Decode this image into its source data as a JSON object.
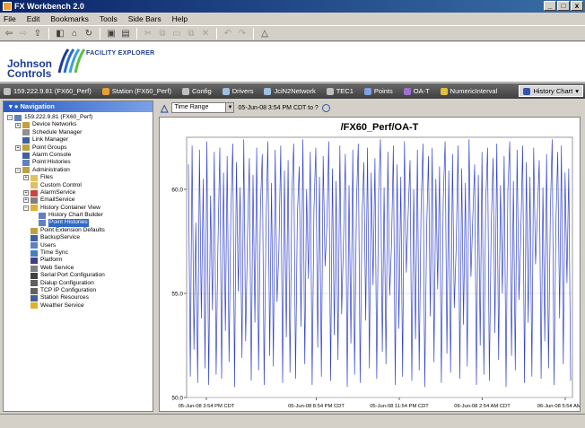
{
  "window": {
    "title": "FX Workbench 2.0",
    "minimize": "_",
    "maximize": "□",
    "close": "x"
  },
  "menu": [
    "File",
    "Edit",
    "Bookmarks",
    "Tools",
    "Side Bars",
    "Help"
  ],
  "banner": {
    "brand_line1": "Johnson",
    "brand_line2": "Controls",
    "product": "FACILITY EXPLORER"
  },
  "path": [
    {
      "label": "159.222.9.81 (FX60_Perf)",
      "color": "#c0c0c0"
    },
    {
      "label": "Station (FX60_Perf)",
      "color": "#e8a030"
    },
    {
      "label": "Config",
      "color": "#c0c0c0"
    },
    {
      "label": "Drivers",
      "color": "#a0c0e0"
    },
    {
      "label": "JciN2Network",
      "color": "#a0c0e0"
    },
    {
      "label": "TEC1",
      "color": "#c0c0c0"
    },
    {
      "label": "Points",
      "color": "#80a0e0"
    },
    {
      "label": "OA-T",
      "color": "#a070d0"
    },
    {
      "label": "NumericInterval",
      "color": "#e0c040"
    }
  ],
  "path_current": "History Chart",
  "nav": {
    "title": "Navigation",
    "items": [
      {
        "label": "159.222.9.81 (FX60_Perf)",
        "level": 0,
        "exp": "−",
        "color": "#6080c0"
      },
      {
        "label": "Device Networks",
        "level": 1,
        "exp": "+",
        "color": "#c0a040"
      },
      {
        "label": "Schedule Manager",
        "level": 1,
        "exp": "",
        "color": "#909090"
      },
      {
        "label": "Link Manager",
        "level": 1,
        "exp": "",
        "color": "#4060a0"
      },
      {
        "label": "Point Groups",
        "level": 1,
        "exp": "+",
        "color": "#c0a040"
      },
      {
        "label": "Alarm Console",
        "level": 1,
        "exp": "",
        "color": "#4060a0"
      },
      {
        "label": "Point Histories",
        "level": 1,
        "exp": "",
        "color": "#6080c0"
      },
      {
        "label": "Administration",
        "level": 1,
        "exp": "−",
        "color": "#c0a040"
      },
      {
        "label": "Files",
        "level": 2,
        "exp": "+",
        "color": "#e0c060"
      },
      {
        "label": "Custom Control",
        "level": 2,
        "exp": "",
        "color": "#e0c060"
      },
      {
        "label": "AlarmService",
        "level": 2,
        "exp": "+",
        "color": "#d04040"
      },
      {
        "label": "EmailService",
        "level": 2,
        "exp": "+",
        "color": "#808080"
      },
      {
        "label": "History Container View",
        "level": 2,
        "exp": "−",
        "color": "#e0b030"
      },
      {
        "label": "History Chart Builder",
        "level": 3,
        "exp": "",
        "color": "#6080c0"
      },
      {
        "label": "Point Histories",
        "level": 3,
        "exp": "",
        "color": "#6080c0",
        "selected": true
      },
      {
        "label": "Point Extension Defaults",
        "level": 2,
        "exp": "",
        "color": "#c0a040"
      },
      {
        "label": "BackupService",
        "level": 2,
        "exp": "",
        "color": "#4060a0"
      },
      {
        "label": "Users",
        "level": 2,
        "exp": "",
        "color": "#6080c0"
      },
      {
        "label": "Time Sync",
        "level": 2,
        "exp": "",
        "color": "#4080c0"
      },
      {
        "label": "Platform",
        "level": 2,
        "exp": "",
        "color": "#404080"
      },
      {
        "label": "Web Service",
        "level": 2,
        "exp": "",
        "color": "#808080"
      },
      {
        "label": "Serial Port Configuration",
        "level": 2,
        "exp": "",
        "color": "#404040"
      },
      {
        "label": "Dialup Configuration",
        "level": 2,
        "exp": "",
        "color": "#606060"
      },
      {
        "label": "TCP IP Configuration",
        "level": 2,
        "exp": "",
        "color": "#606060"
      },
      {
        "label": "Station Resources",
        "level": 2,
        "exp": "",
        "color": "#4060a0"
      },
      {
        "label": "Weather Service",
        "level": 2,
        "exp": "",
        "color": "#e0b030"
      }
    ]
  },
  "chart_toolbar": {
    "range_value": "Time Range",
    "range_text": "05-Jun-08 3:54 PM CDT to ?"
  },
  "chart_data": {
    "type": "line",
    "title": "/FX60_Perf/OA-T",
    "ylim": [
      50,
      62.5
    ],
    "y_ticks": [
      "50.0",
      "55.0",
      "60.0"
    ],
    "y_tick_values": [
      50,
      55,
      60
    ],
    "x_ticks": [
      "05-Jun-08 3:54 PM CDT",
      "05-Jun-08 8:54 PM CDT",
      "05-Jun-08 11:54 PM CDT",
      "06-Jun-08 2:54 AM CDT",
      "06-Jun-08 5:54 AM CDT"
    ],
    "series_color": "#3344cc",
    "grid": true,
    "values": [
      61.2,
      51.0,
      62.1,
      52.3,
      58.4,
      50.7,
      61.9,
      53.8,
      60.5,
      51.4,
      62.3,
      50.6,
      59.7,
      54.2,
      61.8,
      51.1,
      57.3,
      62.0,
      50.9,
      60.8,
      53.2,
      61.6,
      51.7,
      58.9,
      62.2,
      50.5,
      61.3,
      55.1,
      60.1,
      51.9,
      62.4,
      52.7,
      57.8,
      61.5,
      50.8,
      60.7,
      53.6,
      62.0,
      51.3,
      59.2,
      61.7,
      50.6,
      58.1,
      62.3,
      52.0,
      60.3,
      51.5,
      61.9,
      54.6,
      57.0,
      62.1,
      50.7,
      60.9,
      52.9,
      61.4,
      51.2,
      59.6,
      62.2,
      50.9,
      58.7,
      61.1,
      53.4,
      62.4,
      51.6,
      60.0,
      55.7,
      61.8,
      50.6,
      59.0,
      62.0,
      52.4,
      60.6,
      51.0,
      61.6,
      56.3,
      58.2,
      62.3,
      50.8,
      61.0,
      53.0,
      60.4,
      51.8,
      62.1,
      54.0,
      57.6,
      61.7,
      50.5,
      60.2,
      52.6,
      61.9,
      51.1,
      59.4,
      62.2,
      50.7,
      58.5,
      61.3,
      53.7,
      62.0,
      51.4,
      60.8,
      55.4,
      61.5,
      50.9,
      59.8,
      62.4,
      52.2,
      60.1,
      51.6,
      61.8,
      54.9,
      57.4,
      62.1,
      50.6,
      61.2,
      53.3,
      60.6,
      51.0,
      62.3,
      56.0,
      58.8,
      61.4,
      50.8,
      60.0,
      52.8,
      61.9,
      51.3,
      59.1,
      62.2,
      50.5,
      58.0,
      61.6,
      53.9,
      62.0,
      51.7,
      60.5,
      55.2,
      61.1,
      50.7,
      59.5,
      62.3,
      52.1,
      60.9,
      51.2,
      61.7,
      54.3,
      57.2,
      62.1,
      50.9,
      61.0,
      53.5,
      60.3,
      51.5,
      62.4,
      55.8,
      58.6,
      61.2,
      50.6,
      60.7,
      52.5,
      61.8,
      51.1,
      59.3,
      62.0,
      50.8,
      58.3,
      61.5,
      53.1,
      62.2,
      51.8,
      60.2,
      55.0,
      61.6,
      50.5,
      59.9,
      62.3,
      52.0,
      60.4,
      51.3,
      61.9,
      54.7,
      57.7,
      62.1,
      50.7,
      61.3,
      53.6,
      60.6,
      51.0,
      62.0,
      56.4,
      58.9,
      61.4,
      50.9,
      60.1,
      52.7,
      61.7,
      51.4,
      59.0,
      62.4,
      50.6,
      58.2,
      61.8,
      53.8,
      62.1,
      51.6,
      60.8,
      55.5,
      61.0,
      50.8
    ]
  },
  "colors": {
    "accent": "#316ac5",
    "title_bar": "#0a246a",
    "path_bar": "#4e4e4e"
  }
}
